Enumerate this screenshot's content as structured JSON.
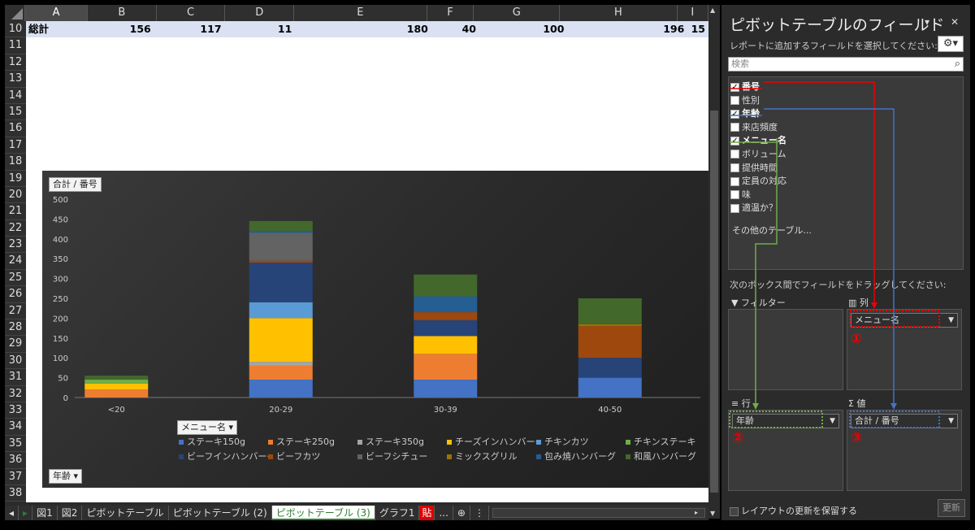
{
  "sheet": {
    "columns": [
      "A",
      "B",
      "C",
      "D",
      "E",
      "F",
      "G",
      "H",
      "I"
    ],
    "rows": [
      "10",
      "11",
      "12",
      "13",
      "14",
      "15",
      "16",
      "17",
      "18",
      "19",
      "20",
      "21",
      "22",
      "23",
      "24",
      "25",
      "26",
      "27",
      "28",
      "29",
      "30",
      "31",
      "32",
      "33",
      "34",
      "35",
      "36",
      "37",
      "38"
    ],
    "total_row": {
      "label": "総計",
      "values": [
        "156",
        "117",
        "11",
        "180",
        "40",
        "100",
        "196",
        "15"
      ]
    }
  },
  "chart": {
    "field_value_button": "合計 / 番号",
    "legend_button": "メニュー名",
    "axis_button": "年齢",
    "legend_items": [
      {
        "label": "ステーキ150g",
        "color": "#4472c4"
      },
      {
        "label": "ステーキ250g",
        "color": "#ed7d31"
      },
      {
        "label": "ステーキ350g",
        "color": "#a5a5a5"
      },
      {
        "label": "チーズインハンバーグ",
        "color": "#ffc000"
      },
      {
        "label": "チキンカツ",
        "color": "#5b9bd5"
      },
      {
        "label": "チキンステーキ",
        "color": "#70ad47"
      },
      {
        "label": "ビーフインハンバーグ",
        "color": "#264478"
      },
      {
        "label": "ビーフカツ",
        "color": "#9e480e"
      },
      {
        "label": "ビーフシチュー",
        "color": "#636363"
      },
      {
        "label": "ミックスグリル",
        "color": "#997300"
      },
      {
        "label": "包み焼ハンバーグ",
        "color": "#255e91"
      },
      {
        "label": "和風ハンバーグ",
        "color": "#43682b"
      }
    ]
  },
  "chart_data": {
    "type": "bar",
    "stacked": true,
    "categories": [
      "<20",
      "20-29",
      "30-39",
      "40-50"
    ],
    "ylim": [
      0,
      500
    ],
    "yticks": [
      0,
      50,
      100,
      150,
      200,
      250,
      300,
      350,
      400,
      450,
      500
    ],
    "series": [
      {
        "name": "ステーキ150g",
        "color": "#4472c4",
        "values": [
          0,
          45,
          45,
          50
        ]
      },
      {
        "name": "ステーキ250g",
        "color": "#ed7d31",
        "values": [
          20,
          35,
          65,
          0
        ]
      },
      {
        "name": "ステーキ350g",
        "color": "#a5a5a5",
        "values": [
          0,
          10,
          0,
          0
        ]
      },
      {
        "name": "チーズインハンバーグ",
        "color": "#ffc000",
        "values": [
          15,
          110,
          45,
          0
        ]
      },
      {
        "name": "チキンカツ",
        "color": "#5b9bd5",
        "values": [
          0,
          40,
          0,
          0
        ]
      },
      {
        "name": "チキンステーキ",
        "color": "#70ad47",
        "values": [
          10,
          0,
          0,
          0
        ]
      },
      {
        "name": "ビーフインハンバーグ",
        "color": "#264478",
        "values": [
          0,
          100,
          40,
          50
        ]
      },
      {
        "name": "ビーフカツ",
        "color": "#9e480e",
        "values": [
          0,
          5,
          20,
          80
        ]
      },
      {
        "name": "ビーフシチュー",
        "color": "#636363",
        "values": [
          0,
          70,
          0,
          0
        ]
      },
      {
        "name": "ミックスグリル",
        "color": "#997300",
        "values": [
          0,
          0,
          0,
          5
        ]
      },
      {
        "name": "包み焼ハンバーグ",
        "color": "#255e91",
        "values": [
          0,
          5,
          40,
          0
        ]
      },
      {
        "name": "和風ハンバーグ",
        "color": "#43682b",
        "values": [
          10,
          25,
          55,
          65
        ]
      }
    ]
  },
  "tabs": {
    "items": [
      "図1",
      "図2",
      "ピボットテーブル",
      "ピボットテーブル (2)",
      "ピボットテーブル (3)",
      "グラフ1",
      "貼"
    ],
    "active": "ピボットテーブル (3)",
    "more": "..."
  },
  "pane": {
    "title": "ピボットテーブルのフィールド",
    "subtitle": "レポートに追加するフィールドを選択してください:",
    "search_placeholder": "検索",
    "fields": [
      {
        "label": "番号",
        "checked": true
      },
      {
        "label": "性別",
        "checked": false
      },
      {
        "label": "年齢",
        "checked": true
      },
      {
        "label": "来店頻度",
        "checked": false
      },
      {
        "label": "メニュー名",
        "checked": true
      },
      {
        "label": "ボリューム",
        "checked": false
      },
      {
        "label": "提供時間",
        "checked": false
      },
      {
        "label": "定員の対応",
        "checked": false
      },
      {
        "label": "味",
        "checked": false
      },
      {
        "label": "適温か？",
        "checked": false
      }
    ],
    "more_tables": "その他のテーブル...",
    "drag_instruction": "次のボックス間でフィールドをドラッグしてください:",
    "filter_label": "フィルター",
    "columns_label": "列",
    "rows_label": "行",
    "values_label": "値",
    "columns_chip": "メニュー名",
    "rows_chip": "年齢",
    "values_chip": "合計 / 番号",
    "defer_label": "レイアウトの更新を保留する",
    "update_label": "更新",
    "annotations": [
      "①",
      "②",
      "③"
    ]
  }
}
